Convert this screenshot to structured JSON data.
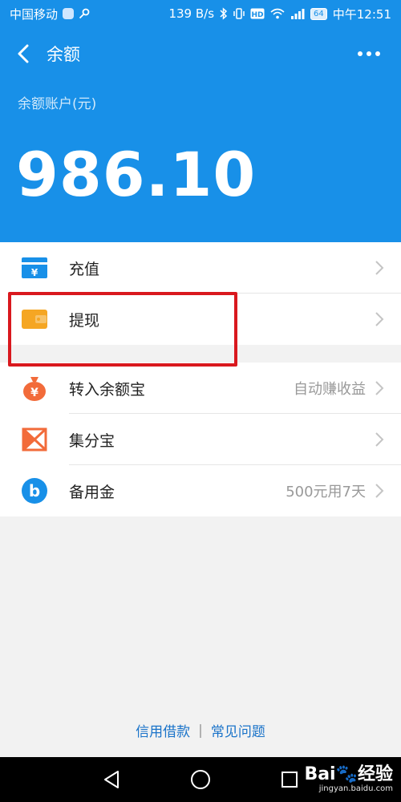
{
  "status_bar": {
    "carrier": "中国移动",
    "speed": "139 B/s",
    "battery": "64",
    "time": "中午12:51"
  },
  "nav": {
    "title": "余额"
  },
  "account": {
    "label": "余额账户(元)",
    "balance": "986.10"
  },
  "menu_section1": [
    {
      "label": "充值",
      "icon": "recharge-icon"
    },
    {
      "label": "提现",
      "icon": "wallet-icon"
    }
  ],
  "menu_section2": [
    {
      "label": "转入余额宝",
      "extra": "自动赚收益",
      "icon": "money-bag-icon"
    },
    {
      "label": "集分宝",
      "extra": "",
      "icon": "points-icon"
    },
    {
      "label": "备用金",
      "extra": "500元用7天",
      "icon": "reserve-fund-icon"
    }
  ],
  "footer": {
    "link1": "信用借款",
    "separator": "|",
    "link2": "常见问题"
  },
  "watermark": {
    "main": "Bai🐾经验",
    "sub": "jingyan.baidu.com"
  },
  "colors": {
    "primary_blue": "#1890e8",
    "highlight_red": "#d9181e",
    "link_blue": "#1a73c9"
  }
}
